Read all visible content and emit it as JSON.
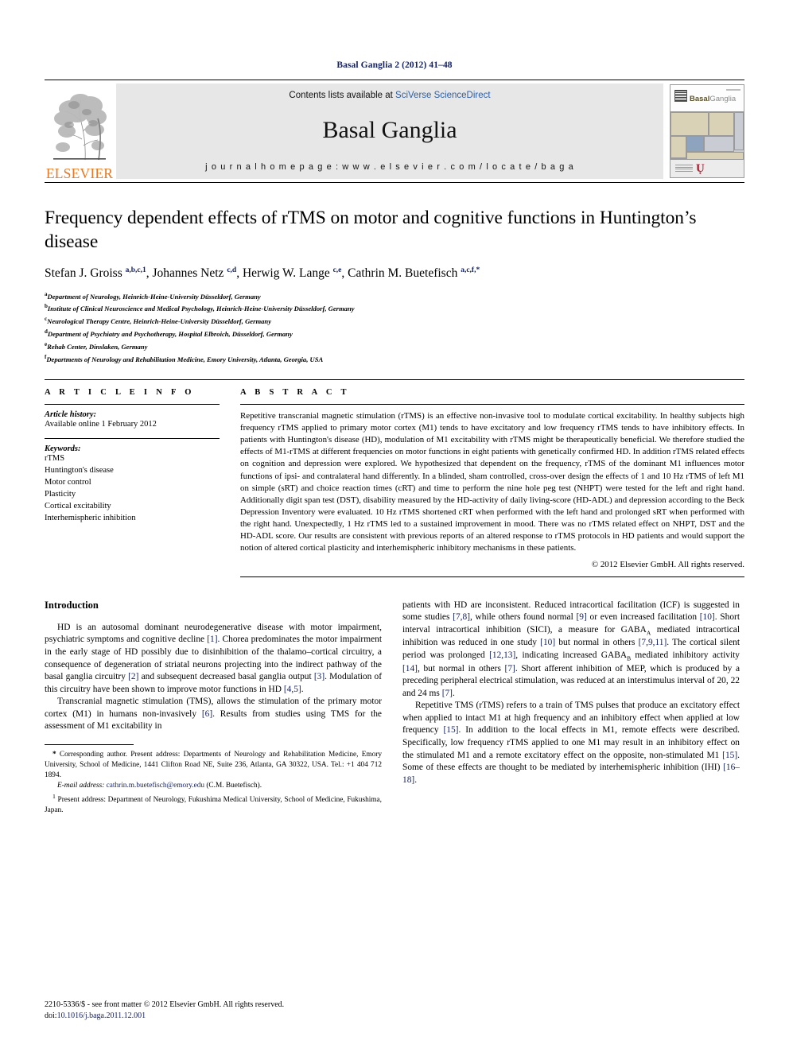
{
  "running_head": "Basal Ganglia 2 (2012) 41–48",
  "masthead": {
    "contents_prefix": "Contents lists available at ",
    "contents_link": "SciVerse ScienceDirect",
    "journal_name": "Basal Ganglia",
    "homepage": "j o u r n a l  h o m e p a g e :  w w w . e l s e v i e r . c o m / l o c a t e / b a g a",
    "publisher": "ELSEVIER",
    "cover_title_bold": "Basal",
    "cover_title_light": "Ganglia"
  },
  "article": {
    "title": "Frequency dependent effects of rTMS on motor and cognitive functions in Huntington’s disease",
    "authors_html": "Stefan J. Groiss <sup>a,b,c,1</sup>, Johannes Netz <sup>c,d</sup>, Herwig W. Lange <sup>c,e</sup>, Cathrin M. Buetefisch <sup>a,c,f,</sup><sup>*</sup>",
    "affiliations": [
      {
        "mark": "a",
        "text": "Department of Neurology, Heinrich-Heine-University Düsseldorf, Germany"
      },
      {
        "mark": "b",
        "text": "Institute of Clinical Neuroscience and Medical Psychology, Heinrich-Heine-University Düsseldorf, Germany"
      },
      {
        "mark": "c",
        "text": "Neurological Therapy Centre, Heinrich-Heine-University Düsseldorf, Germany"
      },
      {
        "mark": "d",
        "text": "Department of Psychiatry and Psychotherapy, Hospital Elbroich, Düsseldorf, Germany"
      },
      {
        "mark": "e",
        "text": "Rehab Center, Dinslaken, Germany"
      },
      {
        "mark": "f",
        "text": "Departments of Neurology and Rehabilitation Medicine, Emory University, Atlanta, Georgia, USA"
      }
    ]
  },
  "article_info": {
    "heading": "A R T I C L E   I N F O",
    "history_label": "Article history:",
    "history_value": "Available online 1 February 2012",
    "keywords_label": "Keywords:",
    "keywords": [
      "rTMS",
      "Huntington's disease",
      "Motor control",
      "Plasticity",
      "Cortical excitability",
      "Interhemispheric inhibition"
    ]
  },
  "abstract": {
    "heading": "A B S T R A C T",
    "text": "Repetitive transcranial magnetic stimulation (rTMS) is an effective non-invasive tool to modulate cortical excitability. In healthy subjects high frequency rTMS applied to primary motor cortex (M1) tends to have excitatory and low frequency rTMS tends to have inhibitory effects. In patients with Huntington's disease (HD), modulation of M1 excitability with rTMS might be therapeutically beneficial. We therefore studied the effects of M1-rTMS at different frequencies on motor functions in eight patients with genetically confirmed HD. In addition rTMS related effects on cognition and depression were explored. We hypothesized that dependent on the frequency, rTMS of the dominant M1 influences motor functions of ipsi- and contralateral hand differently. In a blinded, sham controlled, cross-over design the effects of 1 and 10 Hz rTMS of left M1 on simple (sRT) and choice reaction times (cRT) and time to perform the nine hole peg test (NHPT) were tested for the left and right hand. Additionally digit span test (DST), disability measured by the HD-activity of daily living-score (HD-ADL) and depression according to the Beck Depression Inventory were evaluated. 10 Hz rTMS shortened cRT when performed with the left hand and prolonged sRT when performed with the right hand. Unexpectedly, 1 Hz rTMS led to a sustained improvement in mood. There was no rTMS related effect on NHPT, DST and the HD-ADL score. Our results are consistent with previous reports of an altered response to rTMS protocols in HD patients and would support the notion of altered cortical plasticity and interhemispheric inhibitory mechanisms in these patients.",
    "copyright": "© 2012 Elsevier GmbH. All rights reserved."
  },
  "introduction": {
    "heading": "Introduction",
    "left_paragraphs": [
      "HD is an autosomal dominant neurodegenerative disease with motor impairment, psychiatric symptoms and cognitive decline [1]. Chorea predominates the motor impairment in the early stage of HD possibly due to disinhibition of the thalamo–cortical circuitry, a consequence of degeneration of striatal neurons projecting into the indirect pathway of the basal ganglia circuitry [2] and subsequent decreased basal ganglia output [3]. Modulation of this circuitry have been shown to improve motor functions in HD [4,5].",
      "Transcranial magnetic stimulation (TMS), allows the stimulation of the primary motor cortex (M1) in humans non-invasively [6]. Results from studies using TMS for the assessment of M1 excitability in"
    ],
    "right_paragraphs": [
      "patients with HD are inconsistent. Reduced intracortical facilitation (ICF) is suggested in some studies [7,8], while others found normal [9] or even increased facilitation [10]. Short interval intracortical inhibition (SICI), a measure for GABAA mediated intracortical inhibition was reduced in one study [10] but normal in others [7,9,11]. The cortical silent period was prolonged [12,13], indicating increased GABAB mediated inhibitory activity [14], but normal in others [7]. Short afferent inhibition of MEP, which is produced by a preceding peripheral electrical stimulation, was reduced at an interstimulus interval of 20, 22 and 24 ms [7].",
      "Repetitive TMS (rTMS) refers to a train of TMS pulses that produce an excitatory effect when applied to intact M1 at high frequency and an inhibitory effect when applied at low frequency [15]. In addition to the local effects in M1, remote effects were described. Specifically, low frequency rTMS applied to one M1 may result in an inhibitory effect on the stimulated M1 and a remote excitatory effect on the opposite, non-stimulated M1 [15]. Some of these effects are thought to be mediated by interhemispheric inhibition (IHI) [16–18]."
    ]
  },
  "footnotes": {
    "corresponding": "Corresponding author. Present address: Departments of Neurology and Rehabilitation Medicine, Emory University, School of Medicine, 1441 Clifton Road NE, Suite 236, Atlanta, GA 30322, USA. Tel.: +1 404 712 1894.",
    "email_label": "E-mail address:",
    "email_address": "cathrin.m.buetefisch@emory.edu",
    "email_owner": "(C.M. Buetefisch).",
    "present_address": "Present address: Department of Neurology, Fukushima Medical University, School of Medicine, Fukushima, Japan."
  },
  "page_footer": {
    "issn_line": "2210-5336/$ - see front matter © 2012 Elsevier GmbH. All rights reserved.",
    "doi_label": "doi:",
    "doi_value": "10.1016/j.baga.2011.12.001"
  },
  "colors": {
    "link_blue": "#2b5fa8",
    "ref_blue": "#13205e",
    "elsevier_orange": "#e87722",
    "band_gray": "#e7e7e7"
  }
}
